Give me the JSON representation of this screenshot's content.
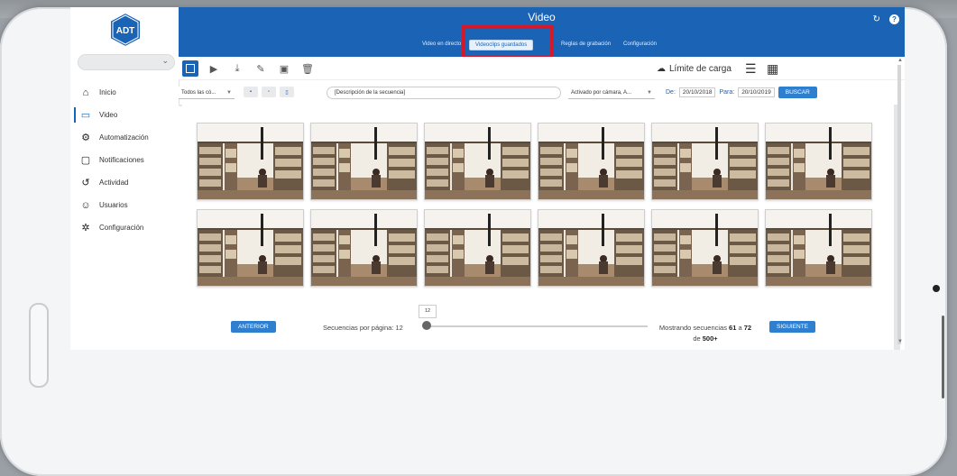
{
  "app": {
    "title": "Video"
  },
  "header_tabs": [
    {
      "label": "Video en directo"
    },
    {
      "label": "Videoclips guardados",
      "selected": true
    },
    {
      "label": "Reglas de grabación"
    },
    {
      "label": "Configuración"
    }
  ],
  "logo_text": "ADT",
  "sidebar": {
    "items": [
      {
        "label": "Inicio",
        "icon": "home-icon"
      },
      {
        "label": "Video",
        "icon": "video-camera-icon",
        "active": true
      },
      {
        "label": "Automatización",
        "icon": "sliders-icon"
      },
      {
        "label": "Notificaciones",
        "icon": "notification-icon"
      },
      {
        "label": "Actividad",
        "icon": "history-icon"
      },
      {
        "label": "Usuarios",
        "icon": "users-icon"
      },
      {
        "label": "Configuración",
        "icon": "gear-icon"
      }
    ]
  },
  "toolbar": {
    "limit_label": "Límite de carga",
    "icons": [
      "select-all-icon",
      "play-icon",
      "download-icon",
      "edit-icon",
      "lock-icon",
      "trash-icon",
      "list-view-icon",
      "grid-view-icon",
      "cloud-upload-icon"
    ]
  },
  "filters": {
    "camera_select": "Todos las có...",
    "description_placeholder": "[Descripción de la secuencia]",
    "trigger_select": "Activado por cámara, A...",
    "from_label": "De:",
    "from_date": "20/10/2018",
    "to_label": "Para:",
    "to_date": "20/10/2019",
    "search_button": "BUSCAR"
  },
  "pagination": {
    "prev": "ANTERIOR",
    "next": "SIGUIENTE",
    "per_page_label": "Secuencias por página: 12",
    "per_page_value": "12",
    "showing_prefix": "Mostrando secuencias",
    "range_start": "61",
    "range_sep": "a",
    "range_end": "72",
    "of_label": "de",
    "total": "500+"
  },
  "thumbnails_count": 12,
  "colors": {
    "header": "#1a63b5",
    "highlight": "#d21a2c",
    "button": "#2f7fd1"
  }
}
